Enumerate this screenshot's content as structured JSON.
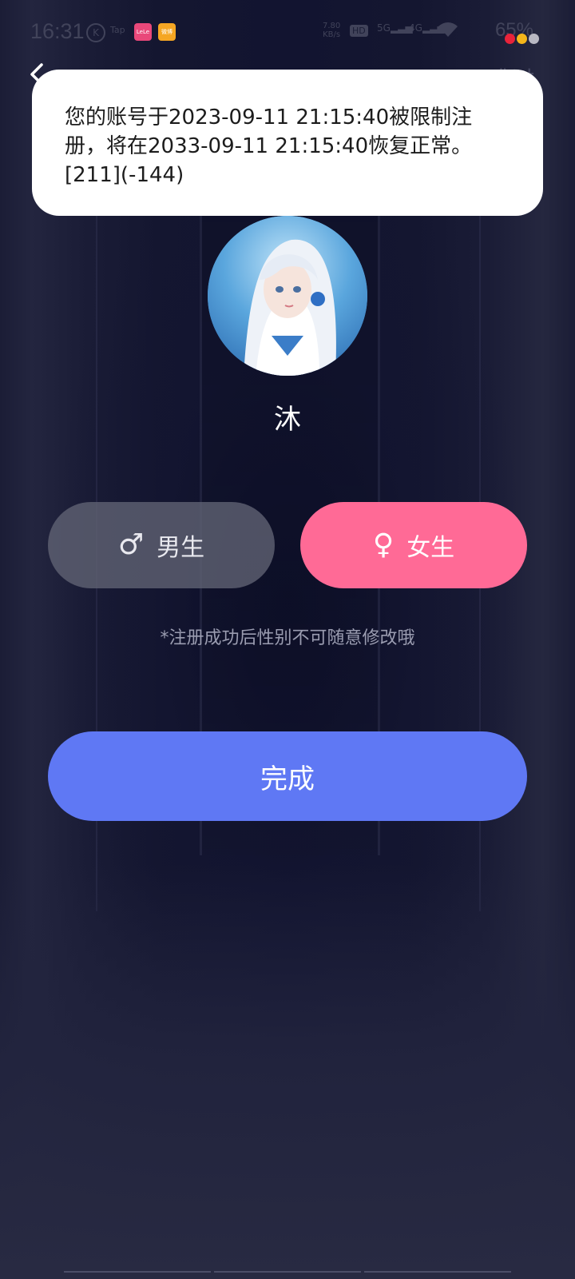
{
  "status_bar": {
    "time": "16:31",
    "k_icon": "K",
    "tap_label": "Tap",
    "app1_label": "LeLe",
    "app2_label": "微博",
    "net_speed_value": "7.80",
    "net_speed_unit": "KB/s",
    "hd_label": "HD",
    "signal1_label": "5G",
    "signal2_label": "4G",
    "battery": "65%",
    "dot_colors": [
      "#e8233a",
      "#f4b51a",
      "#b8b8c2"
    ]
  },
  "nav": {
    "skip_label": "跳过"
  },
  "toast": {
    "message": "您的账号于2023-09-11 21:15:40被限制注册，将在2033-09-11 21:15:40恢复正常。[211](-144)"
  },
  "profile": {
    "nickname": "沐"
  },
  "gender": {
    "male_label": "男生",
    "male_icon": "♂",
    "female_label": "女生",
    "female_icon": "♀",
    "selected": "female",
    "hint": "*注册成功后性别不可随意修改哦"
  },
  "actions": {
    "done_label": "完成"
  },
  "colors": {
    "female_accent": "#ff6a96",
    "primary_button": "#5f78f4"
  }
}
